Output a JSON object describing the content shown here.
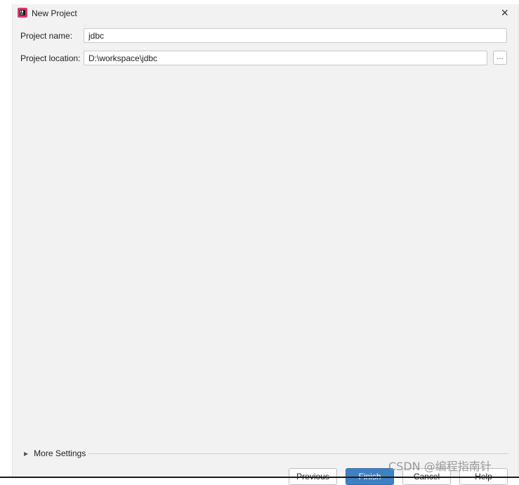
{
  "window": {
    "title": "New Project",
    "close_glyph": "×",
    "app_icon": "intellij-idea-icon"
  },
  "form": {
    "name_label": "Project name:",
    "name_value": "jdbc",
    "location_label": "Project location:",
    "location_value": "D:\\workspace\\jdbc",
    "browse_label": "..."
  },
  "more_settings": {
    "label": "More Settings",
    "icon": "expand-triangle-icon"
  },
  "buttons": {
    "previous": "Previous",
    "finish": "Finish",
    "cancel": "Cancel",
    "help": "Help"
  },
  "watermark": "CSDN @编程指南针",
  "colors": {
    "primary_button": "#3d81c5",
    "dialog_bg": "#f2f2f2"
  }
}
